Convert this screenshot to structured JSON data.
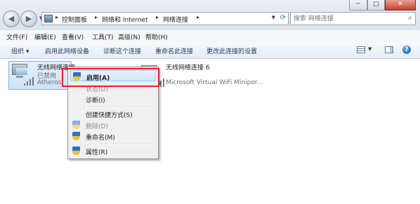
{
  "window": {
    "minimize": "─",
    "maximize": "□",
    "close": "✕"
  },
  "address": {
    "crumbs": [
      "控制面板",
      "网络和 Internet",
      "网络连接"
    ],
    "search_placeholder": "搜索 网络连接"
  },
  "menu": [
    "文件(F)",
    "编辑(E)",
    "查看(V)",
    "工具(T)",
    "高级(N)",
    "帮助(H)"
  ],
  "commands": {
    "organize": "组织 ▾",
    "enable": "启用此网络设备",
    "diagnose": "诊断这个连接",
    "rename": "重命名此连接",
    "change": "更改此连接的设置"
  },
  "items": [
    {
      "name": "无线网络连接",
      "status": "已禁用",
      "adapter": "Atheros"
    },
    {
      "name": "无线网络连接 6",
      "adapter": "Microsoft Virtual WiFi Minipor..."
    }
  ],
  "context_menu": [
    {
      "label": "启用(A)",
      "shield": true,
      "bold": true,
      "highlighted": true,
      "disabled": false
    },
    {
      "label": "状态(U)",
      "shield": false,
      "bold": false,
      "highlighted": false,
      "disabled": true
    },
    {
      "label": "诊断(I)",
      "shield": false,
      "bold": false,
      "highlighted": false,
      "disabled": false
    },
    {
      "label": "创建快捷方式(S)",
      "shield": false,
      "bold": false,
      "highlighted": false,
      "disabled": false
    },
    {
      "label": "删除(D)",
      "shield": true,
      "bold": false,
      "highlighted": false,
      "disabled": true
    },
    {
      "label": "重命名(M)",
      "shield": true,
      "bold": false,
      "highlighted": false,
      "disabled": false
    },
    {
      "label": "属性(R)",
      "shield": true,
      "bold": false,
      "highlighted": false,
      "disabled": false
    }
  ],
  "colors": {
    "highlight_box": "#e81f2a",
    "selection": "#cde3f7",
    "shield_blue": "#2f6fcb",
    "shield_yellow": "#f2c12e"
  }
}
